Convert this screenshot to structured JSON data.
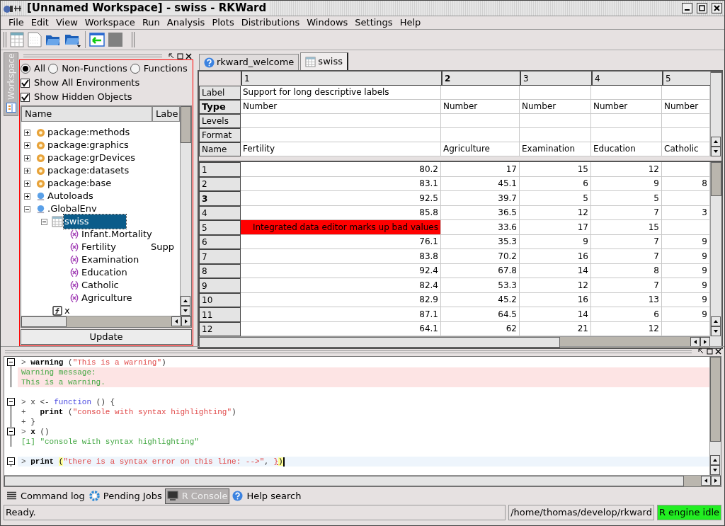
{
  "window": {
    "title": "[Unnamed Workspace] - swiss - RKWard"
  },
  "menu": [
    "File",
    "Edit",
    "View",
    "Workspace",
    "Run",
    "Analysis",
    "Plots",
    "Distributions",
    "Windows",
    "Settings",
    "Help"
  ],
  "side_tab": {
    "label": "Workspace",
    "selected": true
  },
  "workspace": {
    "filters": [
      {
        "label": "All",
        "selected": true
      },
      {
        "label": "Non-Functions",
        "selected": false
      },
      {
        "label": "Functions",
        "selected": false
      }
    ],
    "options": [
      {
        "label": "Show All Environments",
        "checked": true
      },
      {
        "label": "Show Hidden Objects",
        "checked": true
      }
    ],
    "columns": [
      "Name",
      "Labe"
    ],
    "tree": [
      {
        "name": "package:methods",
        "kind": "package",
        "expanded": false,
        "selected": false
      },
      {
        "name": "package:graphics",
        "kind": "package",
        "expanded": false,
        "selected": false
      },
      {
        "name": "package:grDevices",
        "kind": "package",
        "expanded": false,
        "selected": false
      },
      {
        "name": "package:datasets",
        "kind": "package",
        "expanded": false,
        "selected": false
      },
      {
        "name": "package:base",
        "kind": "package",
        "expanded": false,
        "selected": false
      },
      {
        "name": "Autoloads",
        "kind": "environment",
        "expanded": false,
        "selected": false
      },
      {
        "name": ".GlobalEnv",
        "kind": "environment",
        "expanded": true,
        "selected": false,
        "children": [
          {
            "name": "swiss",
            "kind": "dataframe",
            "expanded": true,
            "selected": true,
            "children": [
              {
                "name": "Infant.Mortality",
                "kind": "variable",
                "selected": false
              },
              {
                "name": "Fertility",
                "kind": "variable",
                "selected": false,
                "label": "Supp"
              },
              {
                "name": "Examination",
                "kind": "variable",
                "selected": false
              },
              {
                "name": "Education",
                "kind": "variable",
                "selected": false
              },
              {
                "name": "Catholic",
                "kind": "variable",
                "selected": false
              },
              {
                "name": "Agriculture",
                "kind": "variable",
                "selected": false
              }
            ]
          },
          {
            "name": "x",
            "kind": "function",
            "selected": false
          }
        ]
      }
    ],
    "update_button": "Update"
  },
  "editor": {
    "tabs": [
      {
        "label": "rkward_welcome",
        "kind": "help",
        "selected": false
      },
      {
        "label": "swiss",
        "kind": "data",
        "selected": true
      }
    ],
    "columns": [
      {
        "label": "1",
        "selected": false
      },
      {
        "label": "2",
        "selected": true
      },
      {
        "label": "3",
        "selected": false
      },
      {
        "label": "4",
        "selected": false
      },
      {
        "label": "5",
        "selected": false
      }
    ],
    "meta_rows": [
      {
        "label": "Label",
        "selected": false,
        "cells": [
          "Support for long descriptive labels",
          "",
          "",
          "",
          ""
        ]
      },
      {
        "label": "Type",
        "selected": true,
        "cells": [
          "Number",
          "Number",
          "Number",
          "Number",
          "Number"
        ]
      },
      {
        "label": "Levels",
        "selected": false,
        "cells": [
          "",
          "",
          "",
          "",
          ""
        ]
      },
      {
        "label": "Format",
        "selected": false,
        "cells": [
          "",
          "",
          "",
          "",
          ""
        ]
      },
      {
        "label": "Name",
        "selected": false,
        "cells": [
          "Fertility",
          "Agriculture",
          "Examination",
          "Education",
          "Catholic"
        ]
      }
    ],
    "rows": [
      {
        "label": "1",
        "selected": false,
        "cells": [
          {
            "text": "80.2",
            "invalid": false
          },
          {
            "text": "17",
            "invalid": false
          },
          {
            "text": "15",
            "invalid": false
          },
          {
            "text": "12",
            "invalid": false
          }
        ]
      },
      {
        "label": "2",
        "selected": false,
        "cells": [
          {
            "text": "83.1",
            "invalid": false
          },
          {
            "text": "45.1",
            "invalid": false
          },
          {
            "text": "6",
            "invalid": false
          },
          {
            "text": "9",
            "invalid": false
          },
          {
            "text": "8",
            "invalid": false
          }
        ]
      },
      {
        "label": "3",
        "selected": true,
        "cells": [
          {
            "text": "92.5",
            "invalid": false
          },
          {
            "text": "39.7",
            "invalid": false
          },
          {
            "text": "5",
            "invalid": false
          },
          {
            "text": "5",
            "invalid": false
          }
        ]
      },
      {
        "label": "4",
        "selected": false,
        "cells": [
          {
            "text": "85.8",
            "invalid": false
          },
          {
            "text": "36.5",
            "invalid": false
          },
          {
            "text": "12",
            "invalid": false
          },
          {
            "text": "7",
            "invalid": false
          },
          {
            "text": "3",
            "invalid": false
          }
        ]
      },
      {
        "label": "5",
        "selected": false,
        "cells": [
          {
            "text": "Integrated data editor marks up bad values",
            "invalid": true
          },
          {
            "text": "33.6",
            "invalid": false
          },
          {
            "text": "17",
            "invalid": false
          },
          {
            "text": "15",
            "invalid": false
          }
        ]
      },
      {
        "label": "6",
        "selected": false,
        "cells": [
          {
            "text": "76.1",
            "invalid": false
          },
          {
            "text": "35.3",
            "invalid": false
          },
          {
            "text": "9",
            "invalid": false
          },
          {
            "text": "7",
            "invalid": false
          },
          {
            "text": "9",
            "invalid": false
          }
        ]
      },
      {
        "label": "7",
        "selected": false,
        "cells": [
          {
            "text": "83.8",
            "invalid": false
          },
          {
            "text": "70.2",
            "invalid": false
          },
          {
            "text": "16",
            "invalid": false
          },
          {
            "text": "7",
            "invalid": false
          },
          {
            "text": "9",
            "invalid": false
          }
        ]
      },
      {
        "label": "8",
        "selected": false,
        "cells": [
          {
            "text": "92.4",
            "invalid": false
          },
          {
            "text": "67.8",
            "invalid": false
          },
          {
            "text": "14",
            "invalid": false
          },
          {
            "text": "8",
            "invalid": false
          },
          {
            "text": "9",
            "invalid": false
          }
        ]
      },
      {
        "label": "9",
        "selected": false,
        "cells": [
          {
            "text": "82.4",
            "invalid": false
          },
          {
            "text": "53.3",
            "invalid": false
          },
          {
            "text": "12",
            "invalid": false
          },
          {
            "text": "7",
            "invalid": false
          },
          {
            "text": "9",
            "invalid": false
          }
        ]
      },
      {
        "label": "10",
        "selected": false,
        "cells": [
          {
            "text": "82.9",
            "invalid": false
          },
          {
            "text": "45.2",
            "invalid": false
          },
          {
            "text": "16",
            "invalid": false
          },
          {
            "text": "13",
            "invalid": false
          },
          {
            "text": "9",
            "invalid": false
          }
        ]
      },
      {
        "label": "11",
        "selected": false,
        "cells": [
          {
            "text": "87.1",
            "invalid": false
          },
          {
            "text": "64.5",
            "invalid": false
          },
          {
            "text": "14",
            "invalid": false
          },
          {
            "text": "6",
            "invalid": false
          },
          {
            "text": "9",
            "invalid": false
          }
        ]
      },
      {
        "label": "12",
        "selected": false,
        "cells": [
          {
            "text": "64.1",
            "invalid": false
          },
          {
            "text": "62",
            "invalid": false
          },
          {
            "text": "21",
            "invalid": false
          },
          {
            "text": "12",
            "invalid": false
          }
        ]
      }
    ]
  },
  "console": {
    "blocks": [
      {
        "current": false,
        "gap_after": true,
        "lines": [
          {
            "kind": "input",
            "tokens": [
              {
                "kind": "prompt",
                "text": "> "
              },
              {
                "kind": "call",
                "text": "warning"
              },
              {
                "kind": "plain",
                "text": " ("
              },
              {
                "kind": "string",
                "text": "\"This is a warning\""
              },
              {
                "kind": "plain",
                "text": ")"
              }
            ]
          },
          {
            "kind": "warning",
            "tokens": [
              {
                "kind": "output",
                "text": "Warning message:"
              }
            ]
          },
          {
            "kind": "warning",
            "tokens": [
              {
                "kind": "output",
                "text": "This is a warning."
              }
            ]
          }
        ]
      },
      {
        "current": false,
        "gap_after": false,
        "lines": [
          {
            "kind": "input",
            "tokens": [
              {
                "kind": "prompt",
                "text": "> "
              },
              {
                "kind": "plain",
                "text": "x <- "
              },
              {
                "kind": "reserved",
                "text": "function"
              },
              {
                "kind": "plain",
                "text": " () {"
              }
            ]
          },
          {
            "kind": "input",
            "tokens": [
              {
                "kind": "prompt",
                "text": "+   "
              },
              {
                "kind": "call",
                "text": "print"
              },
              {
                "kind": "plain",
                "text": " ("
              },
              {
                "kind": "string",
                "text": "\"console with syntax highlighting\""
              },
              {
                "kind": "plain",
                "text": ")"
              }
            ]
          },
          {
            "kind": "input",
            "tokens": [
              {
                "kind": "prompt",
                "text": "+ "
              },
              {
                "kind": "plain",
                "text": "}"
              }
            ]
          }
        ]
      },
      {
        "current": false,
        "gap_after": true,
        "lines": [
          {
            "kind": "input",
            "tokens": [
              {
                "kind": "prompt",
                "text": "> "
              },
              {
                "kind": "call",
                "text": "x"
              },
              {
                "kind": "plain",
                "text": " ()"
              }
            ]
          },
          {
            "kind": "output",
            "tokens": [
              {
                "kind": "output",
                "text": "[1] \"console with syntax highlighting\""
              }
            ]
          }
        ]
      },
      {
        "current": true,
        "gap_after": false,
        "lines": [
          {
            "kind": "input",
            "tokens": [
              {
                "kind": "prompt",
                "text": "> "
              },
              {
                "kind": "call",
                "text": "print "
              },
              {
                "kind": "match",
                "text": "("
              },
              {
                "kind": "string",
                "text": "\"there is a syntax error on this line: -->\""
              },
              {
                "kind": "plain",
                "text": ", "
              },
              {
                "kind": "error",
                "text": "}"
              },
              {
                "kind": "match",
                "text": ")"
              }
            ]
          }
        ]
      }
    ]
  },
  "bottom_tabs": [
    {
      "label": "Command log",
      "kind": "log",
      "selected": false
    },
    {
      "label": "Pending Jobs",
      "kind": "jobs",
      "selected": false
    },
    {
      "label": "R Console",
      "kind": "console",
      "selected": true
    },
    {
      "label": "Help search",
      "kind": "help",
      "selected": false
    }
  ],
  "status_bar": {
    "message": "Ready.",
    "path": "/home/thomas/develop/rkward",
    "engine": "R engine idle"
  }
}
